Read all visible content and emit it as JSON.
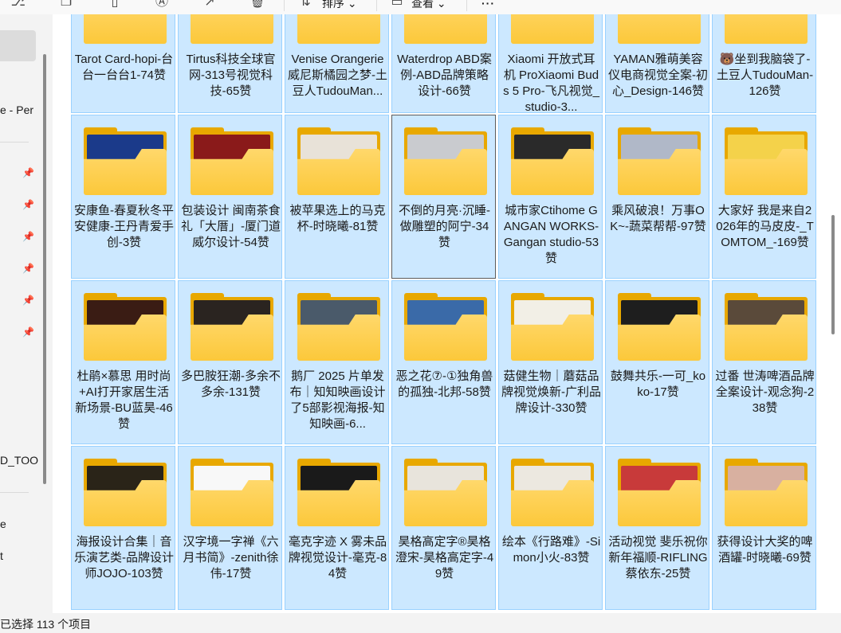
{
  "toolbar": {
    "sort_label": "排序",
    "view_label": "查看",
    "more_label": "···"
  },
  "nav": {
    "item1": "e - Per",
    "item2": "D_TOO",
    "item3": "e",
    "item4": "t"
  },
  "status": {
    "selection": "选择 113 个项目",
    "prefix": "已"
  },
  "folders": [
    {
      "label": "Tarot Card-hopi-台台一台台1-74赞",
      "thumb": "none"
    },
    {
      "label": "Tirtus科技全球官网-313号视觉科技-65赞",
      "thumb": "none"
    },
    {
      "label": "Venise Orangerie 威尼斯橘园之梦-土豆人TudouMan...",
      "thumb": "none"
    },
    {
      "label": "Waterdrop ABD案例-ABD品牌策略设计-66赞",
      "thumb": "none"
    },
    {
      "label": "Xiaomi 开放式耳机 ProXiaomi Buds 5 Pro-飞凡视觉_studio-3...",
      "thumb": "none"
    },
    {
      "label": "YAMAN雅萌美容仪电商视觉全案-初心_Design-146赞",
      "thumb": "none"
    },
    {
      "label": "🐻坐到我脑袋了-土豆人TudouMan-126赞",
      "thumb": "none"
    },
    {
      "label": "安康鱼-春夏秋冬平安健康-王丹青爱手创-3赞",
      "thumb": "#1b3a8a"
    },
    {
      "label": "包装设计 闽南茶食礼「大厝」-厦门道威尔设计-54赞",
      "thumb": "#8a1a1a"
    },
    {
      "label": "被苹果选上的马克杯-时晓曦-81赞",
      "thumb": "#e8e2d8"
    },
    {
      "label": "不倒的月亮·沉睡-做雕塑的阿宁-34赞",
      "thumb": "#c9cbcf"
    },
    {
      "label": "城市家Ctihome GANGAN WORKS-Gangan studio-53赞",
      "thumb": "#2a2a2a"
    },
    {
      "label": "乘风破浪！万事OK~-蔬菜帮帮-97赞",
      "thumb": "#b0b8c8"
    },
    {
      "label": "大家好 我是来自2026年的马皮皮-_TOMTOM_-169赞",
      "thumb": "#f4d24a"
    },
    {
      "label": "杜鹃×慕思 用时尚+AI打开家居生活新场景-BU蓝昊-46赞",
      "thumb": "#3a1c14"
    },
    {
      "label": "多巴胺狂潮-多余不多余-131赞",
      "thumb": "#2a2420"
    },
    {
      "label": "鹅厂 2025 片单发布｜知知映画设计了5部影视海报-知知映画-6...",
      "thumb": "#4a5a6a"
    },
    {
      "label": "恶之花⑦-①独角兽的孤独-北邦-58赞",
      "thumb": "#3a6aa8"
    },
    {
      "label": "菇健生物｜蘑菇品牌视觉焕新-广利品牌设计-330赞",
      "thumb": "#f2efe6"
    },
    {
      "label": "鼓舞共乐-一可_koko-17赞",
      "thumb": "#1e1e1e"
    },
    {
      "label": "过番 世涛啤酒品牌全案设计-观念狗-238赞",
      "thumb": "#5a4a3a"
    },
    {
      "label": "海报设计合集｜音乐演艺类-品牌设计师JOJO-103赞",
      "thumb": "#2a2418"
    },
    {
      "label": "汉字境一字禅《六月书简》-zenith徐伟-17赞",
      "thumb": "#f8f8f8"
    },
    {
      "label": "毫克字迹 X 雾未品牌视觉设计-毫克-84赞",
      "thumb": "#1a1a1a"
    },
    {
      "label": "昊格高定字®昊格澄宋-昊格高定字-49赞",
      "thumb": "#e8e4dc"
    },
    {
      "label": "绘本《行路难》-Simon小火-83赞",
      "thumb": "#ece8e0"
    },
    {
      "label": "活动视觉 斐乐祝你新年福顺-RIFLING蔡依东-25赞",
      "thumb": "#c83a3a"
    },
    {
      "label": "获得设计大奖的啤酒罐-时晓曦-69赞",
      "thumb": "#d8b0a0"
    }
  ]
}
